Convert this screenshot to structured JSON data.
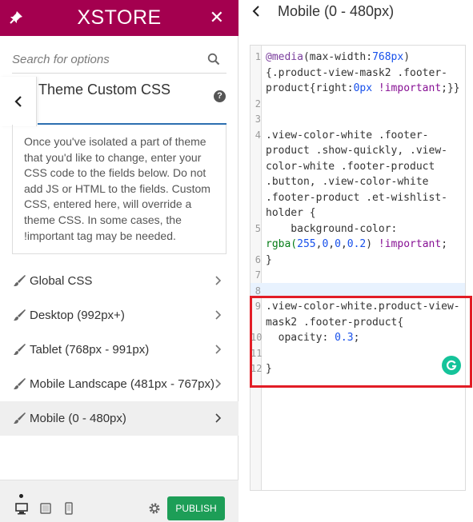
{
  "brand": {
    "name": "XSTORE",
    "color": "#a4004f"
  },
  "search": {
    "placeholder": "Search for options"
  },
  "section": {
    "title": "Theme Custom CSS",
    "description": "Once you've isolated a part of theme that you'd like to change, enter your CSS code to the fields below. Do not add JS or HTML to the fields. Custom CSS, entered here, will override a theme CSS. In some cases, the !important tag may be needed."
  },
  "nav": {
    "items": [
      {
        "label": "Global CSS",
        "icon": "brush-icon"
      },
      {
        "label": "Desktop (992px+)",
        "icon": "brush-icon"
      },
      {
        "label": "Tablet (768px - 991px)",
        "icon": "brush-icon"
      },
      {
        "label": "Mobile Landscape (481px - 767px)",
        "icon": "brush-icon"
      },
      {
        "label": "Mobile (0 - 480px)",
        "icon": "brush-icon",
        "active": true
      }
    ]
  },
  "footer": {
    "publish_label": "PUBLISH",
    "publish_color": "#1d9e57"
  },
  "editor": {
    "title": "Mobile (0 - 480px)",
    "line_numbers": [
      "1",
      "2",
      "3",
      "4",
      "5",
      "6",
      "7",
      "8",
      "9",
      "10",
      "11",
      "12"
    ],
    "lines": {
      "l1a": "@media",
      "l1b": "(max-width:",
      "l1c": "768px",
      "l1d": ")",
      "l1e": "{.product-view-mask2 .footer-",
      "l1f": "product{right:",
      "l1g": "0px",
      "l1h": " !important",
      "l1i": ";}}",
      "l4a": ".view-color-white .footer-",
      "l4b": "product .show-quickly, .view-",
      "l4c": "color-white .footer-product",
      "l4d": ".button, .view-color-white",
      "l4e": ".footer-product .et-wishlist-",
      "l4f": "holder {",
      "l5a": "    background-color:",
      "l5b": "rgba(",
      "l5c": "255",
      "l5d": ",",
      "l5e": "0",
      "l5f": ",",
      "l5g": "0",
      "l5h": ",",
      "l5i": "0.2",
      "l5j": ") ",
      "l5k": "!important",
      "l5l": ";",
      "l6": "}",
      "l9a": ".view-color-white.product-view-",
      "l9b": "mask2 .footer-product{",
      "l10a": "  opacity: ",
      "l10b": "0.3",
      "l10c": ";",
      "l12": "}"
    }
  },
  "colors": {
    "highlight": "#e21d26",
    "grammarly": "#15c39a",
    "active_tab": "#2d6fb0"
  }
}
